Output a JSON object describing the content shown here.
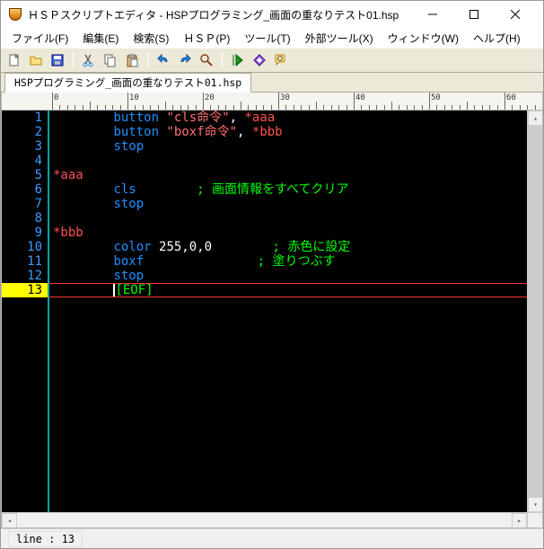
{
  "window": {
    "title": "ＨＳＰスクリプトエディタ - HSPプログラミング_画面の重なりテスト01.hsp"
  },
  "menubar": {
    "file": "ファイル(F)",
    "edit": "編集(E)",
    "search": "検索(S)",
    "hsp": "ＨＳＰ(P)",
    "tools": "ツール(T)",
    "exttools": "外部ツール(X)",
    "window": "ウィンドウ(W)",
    "help": "ヘルプ(H)"
  },
  "tabs": {
    "active": "HSPプログラミング_画面の重なりテスト01.hsp"
  },
  "editor": {
    "lines": [
      {
        "num": "1",
        "segs": [
          {
            "c": "tok-func",
            "t": "\tbutton "
          },
          {
            "c": "tok-str",
            "t": "\"cls命令\""
          },
          {
            "c": "",
            "t": ", "
          },
          {
            "c": "tok-label",
            "t": "*aaa"
          }
        ]
      },
      {
        "num": "2",
        "segs": [
          {
            "c": "tok-func",
            "t": "\tbutton "
          },
          {
            "c": "tok-str",
            "t": "\"boxf命令\""
          },
          {
            "c": "",
            "t": ", "
          },
          {
            "c": "tok-label",
            "t": "*bbb"
          }
        ]
      },
      {
        "num": "3",
        "segs": [
          {
            "c": "tok-func",
            "t": "\tstop"
          }
        ]
      },
      {
        "num": "4",
        "segs": []
      },
      {
        "num": "5",
        "segs": [
          {
            "c": "tok-label",
            "t": "*aaa"
          }
        ]
      },
      {
        "num": "6",
        "segs": [
          {
            "c": "tok-func",
            "t": "\tcls"
          },
          {
            "c": "",
            "t": "        "
          },
          {
            "c": "tok-cmt",
            "t": "; 画面情報をすべてクリア"
          }
        ]
      },
      {
        "num": "7",
        "segs": [
          {
            "c": "tok-func",
            "t": "\tstop"
          }
        ]
      },
      {
        "num": "8",
        "segs": []
      },
      {
        "num": "9",
        "segs": [
          {
            "c": "tok-label",
            "t": "*bbb"
          }
        ]
      },
      {
        "num": "10",
        "segs": [
          {
            "c": "tok-func",
            "t": "\tcolor "
          },
          {
            "c": "tok-num",
            "t": "255,0,0"
          },
          {
            "c": "",
            "t": "        "
          },
          {
            "c": "tok-cmt",
            "t": "; 赤色に設定"
          }
        ]
      },
      {
        "num": "11",
        "segs": [
          {
            "c": "tok-func",
            "t": "\tboxf"
          },
          {
            "c": "",
            "t": "               "
          },
          {
            "c": "tok-cmt",
            "t": "; 塗りつぶす"
          }
        ]
      },
      {
        "num": "12",
        "segs": [
          {
            "c": "tok-func",
            "t": "\tstop"
          }
        ]
      },
      {
        "num": "13",
        "current": true,
        "segs": [
          {
            "c": "",
            "t": "\t"
          },
          {
            "c": "tok-eof",
            "t": "[EOF]"
          }
        ]
      }
    ]
  },
  "status": {
    "line": "line : 13"
  },
  "ruler": {
    "majors": [
      0,
      10,
      20,
      30,
      40,
      50,
      60
    ]
  }
}
